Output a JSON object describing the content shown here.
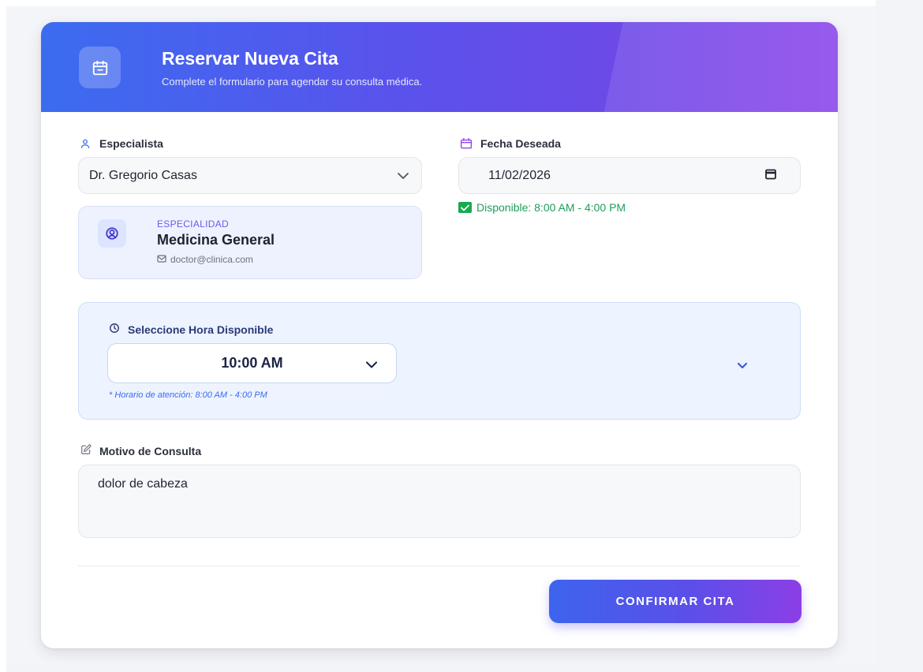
{
  "header": {
    "title": "Reservar Nueva Cita",
    "subtitle": "Complete el formulario para agendar su consulta médica.",
    "icon": "calendar-icon"
  },
  "specialist": {
    "label": "Especialista",
    "icon": "user-icon",
    "selected": "Dr. Gregorio Casas"
  },
  "date": {
    "label": "Fecha Deseada",
    "icon": "calendar-icon",
    "value": "11/02/2026",
    "availability": "Disponible: 8:00 AM - 4:00 PM"
  },
  "doctor_card": {
    "kicker": "ESPECIALIDAD",
    "specialty": "Medicina General",
    "email": "doctor@clinica.com"
  },
  "time": {
    "label": "Seleccione Hora Disponible",
    "selected": "10:00 AM",
    "hint": "* Horario de atención: 8:00 AM - 4:00 PM"
  },
  "reason": {
    "label": "Motivo de Consulta",
    "value": "dolor de cabeza"
  },
  "actions": {
    "confirm_label": "CONFIRMAR CITA"
  },
  "colors": {
    "accent_blue": "#3b6cf0",
    "accent_purple": "#8d48ea",
    "success_green": "#1e9e5a"
  }
}
